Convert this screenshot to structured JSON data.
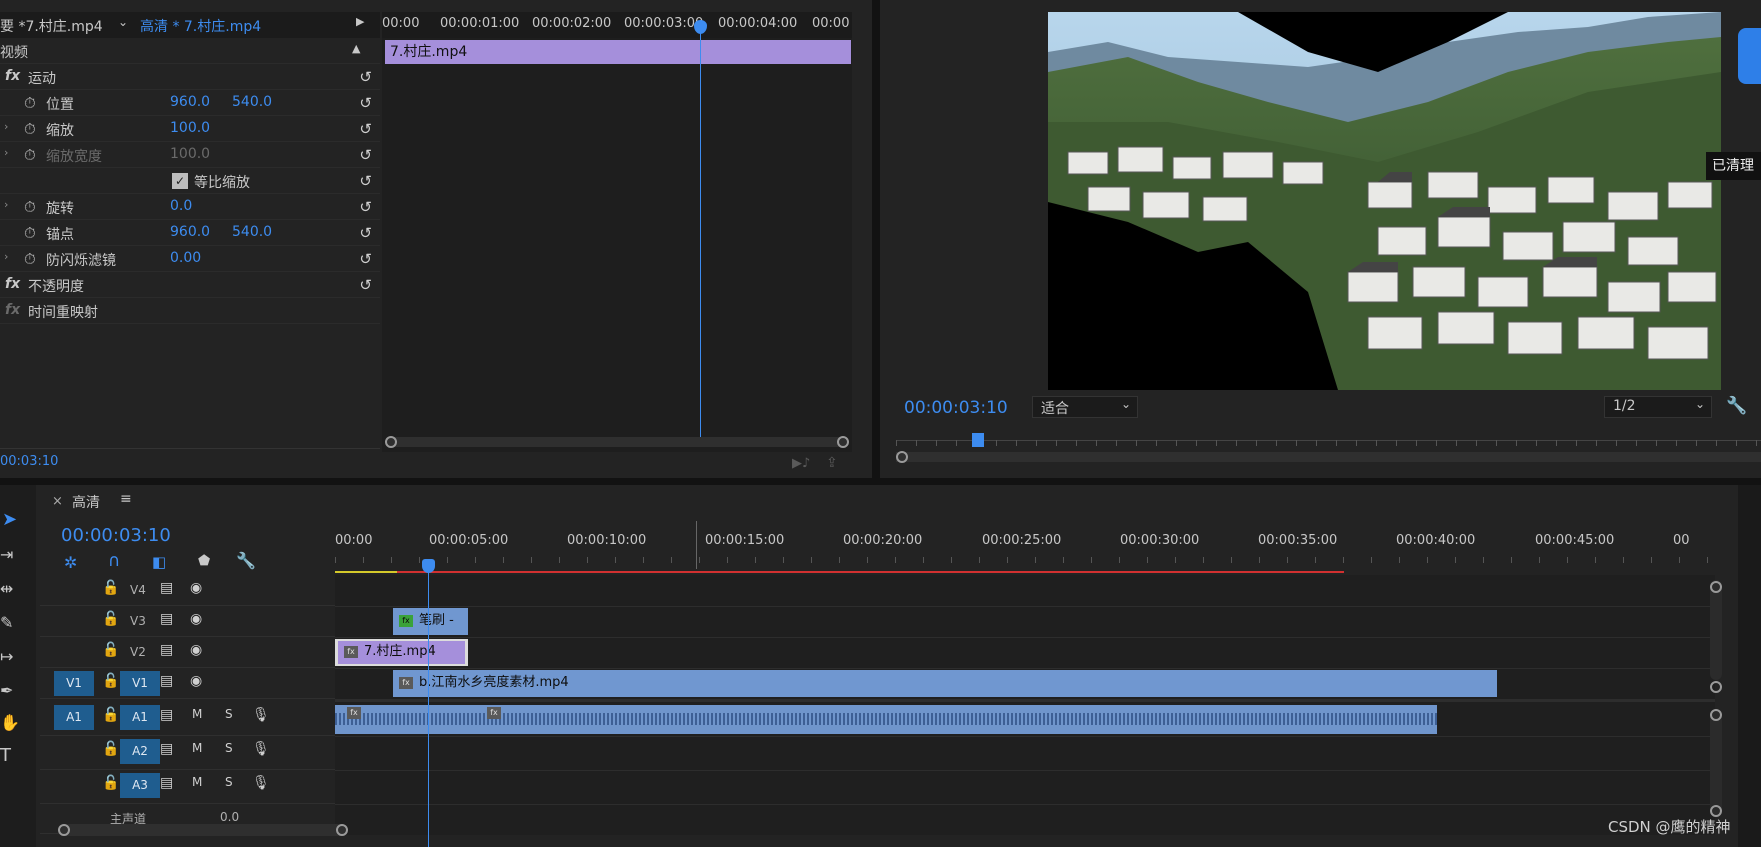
{
  "effect_controls": {
    "tab_master": "要 *7.村庄.mp4",
    "tab_sequence": "高清 * 7.村庄.mp4",
    "video_section": "视频",
    "rows": {
      "motion": "运动",
      "position": "位置",
      "position_x": "960.0",
      "position_y": "540.0",
      "scale": "缩放",
      "scale_value": "100.0",
      "scale_width": "缩放宽度",
      "scale_width_value": "100.0",
      "uniform_scale": "等比缩放",
      "rotation": "旋转",
      "rotation_value": "0.0",
      "anchor": "锚点",
      "anchor_x": "960.0",
      "anchor_y": "540.0",
      "anti_flicker": "防闪烁滤镜",
      "anti_flicker_value": "0.00",
      "opacity": "不透明度",
      "time_remap": "时间重映射"
    },
    "timecode": "00:03:10",
    "mini_ruler": [
      "00:00",
      "00:00:01:00",
      "00:00:02:00",
      "00:00:03:00",
      "00:00:04:00",
      "00:00"
    ],
    "mini_clip": "7.村庄.mp4"
  },
  "program": {
    "timecode": "00:00:03:10",
    "fit": "适合",
    "resolution": "1/2",
    "tooltip": "已清理"
  },
  "timeline": {
    "title": "高清",
    "timecode": "00:00:03:10",
    "ruler": [
      "00:00",
      "00:00:05:00",
      "00:00:10:00",
      "00:00:15:00",
      "00:00:20:00",
      "00:00:25:00",
      "00:00:30:00",
      "00:00:35:00",
      "00:00:40:00",
      "00:00:45:00",
      "00"
    ],
    "tracks": {
      "v4": "V4",
      "v3": "V3",
      "v2": "V2",
      "v1_src": "V1",
      "v1": "V1",
      "a1_src": "A1",
      "a1": "A1",
      "a2": "A2",
      "a3": "A3",
      "m": "M",
      "s": "S",
      "master": "主声道",
      "master_value": "0.0"
    },
    "clips": {
      "v3": "笔刷 -",
      "v2": "7.村庄.mp4",
      "v1": "b.江南水乡亮度素材.mp4"
    }
  },
  "watermark": "CSDN @鹰的精神",
  "colors": {
    "accent": "#3d8cf0",
    "clip_purple": "#a58fdb",
    "clip_blue": "#7097d0",
    "audio_blue": "#6f95cc",
    "work_area_red": "#d13030"
  }
}
